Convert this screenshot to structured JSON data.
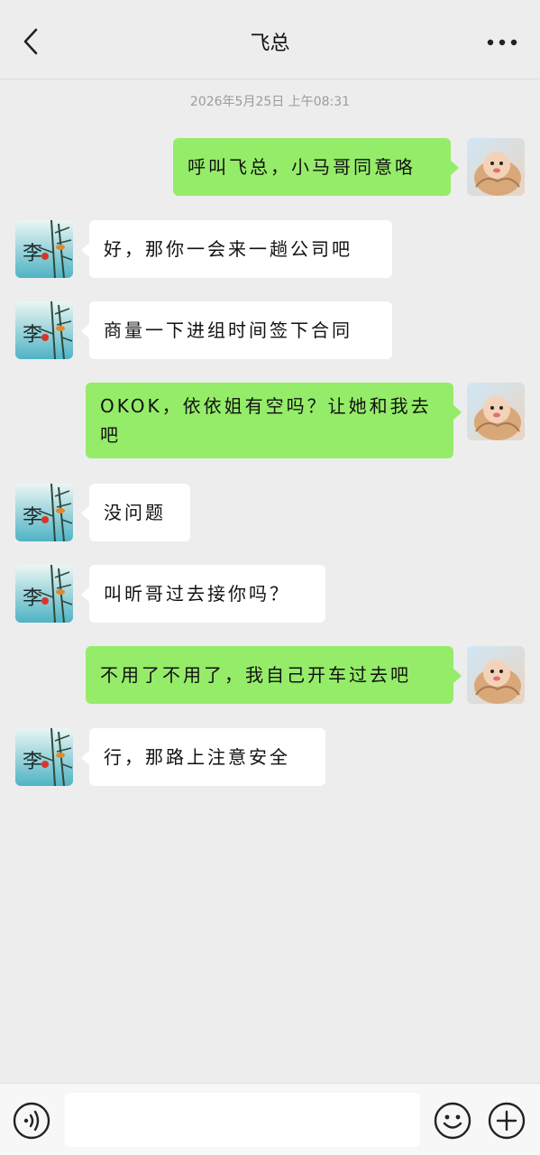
{
  "header": {
    "title": "飞总",
    "back_icon": "chevron-left-icon",
    "more_icon": "more-dots-icon"
  },
  "timestamp": "2026年5月25日 上午08:31",
  "messages": [
    {
      "side": "out",
      "text": "呼叫飞总，小马哥同意咯"
    },
    {
      "side": "in",
      "text": "好，那你一会来一趟公司吧"
    },
    {
      "side": "in",
      "text": "商量一下进组时间签下合同"
    },
    {
      "side": "out",
      "text": "OKOK，依依姐有空吗？让她和我去吧"
    },
    {
      "side": "in",
      "text": "没问题"
    },
    {
      "side": "in",
      "text": "叫昕哥过去接你吗？"
    },
    {
      "side": "out",
      "text": "不用了不用了，我自己开车过去吧"
    },
    {
      "side": "in",
      "text": "行，那路上注意安全"
    }
  ],
  "footer": {
    "voice_icon": "voice-icon",
    "emoji_icon": "emoji-icon",
    "plus_icon": "plus-icon",
    "input_value": ""
  },
  "colors": {
    "background": "#ededed",
    "outgoing_bubble": "#95ec69",
    "incoming_bubble": "#ffffff"
  }
}
